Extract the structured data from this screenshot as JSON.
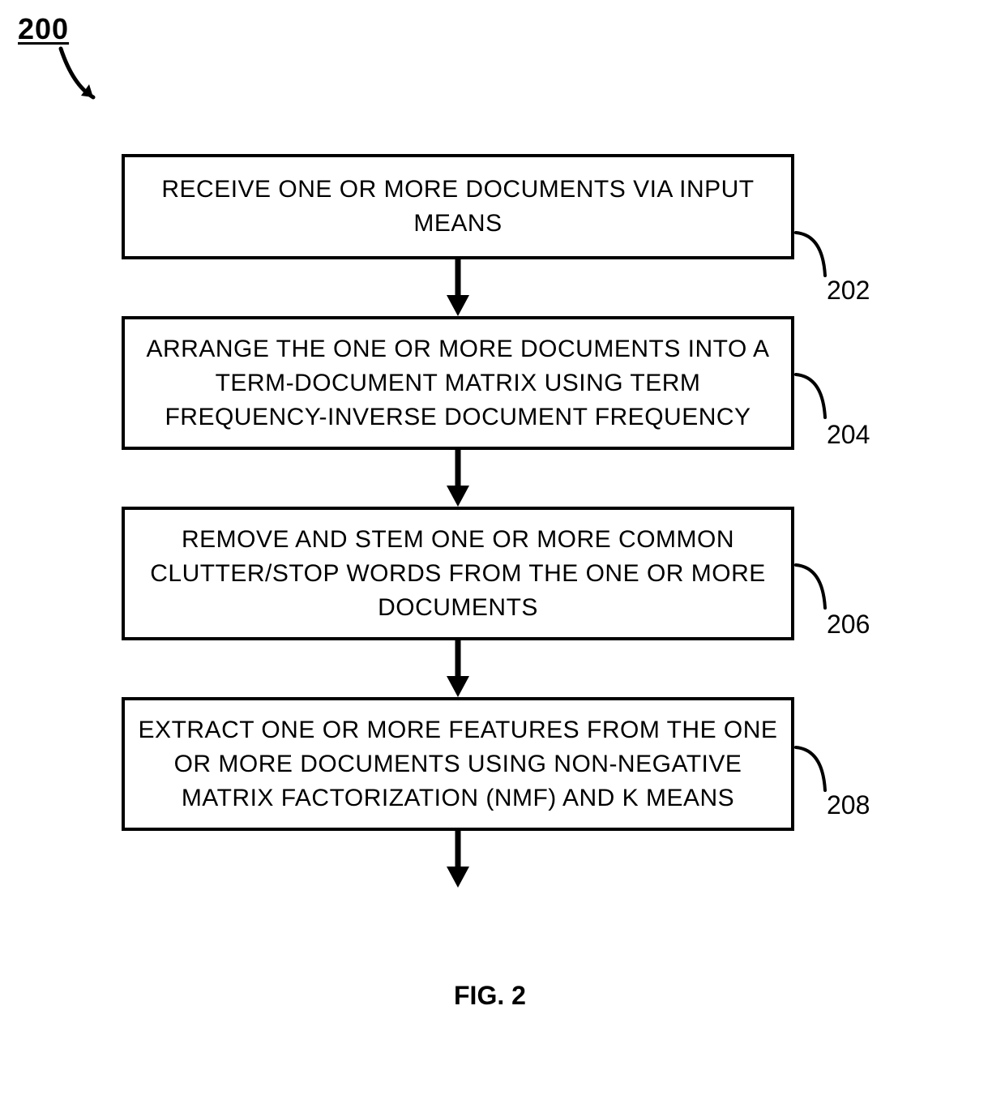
{
  "figure_label": "200",
  "caption": "FIG. 2",
  "steps": [
    {
      "num": "202",
      "text": "RECEIVE ONE OR MORE DOCUMENTS VIA INPUT MEANS"
    },
    {
      "num": "204",
      "text": "ARRANGE THE ONE OR MORE DOCUMENTS INTO A TERM-DOCUMENT MATRIX USING TERM FREQUENCY-INVERSE DOCUMENT FREQUENCY"
    },
    {
      "num": "206",
      "text": "REMOVE AND STEM ONE OR MORE COMMON CLUTTER/STOP WORDS FROM THE ONE OR MORE DOCUMENTS"
    },
    {
      "num": "208",
      "text": "EXTRACT ONE OR MORE FEATURES FROM THE ONE OR MORE DOCUMENTS USING NON-NEGATIVE MATRIX FACTORIZATION (NMF) AND K MEANS"
    }
  ]
}
